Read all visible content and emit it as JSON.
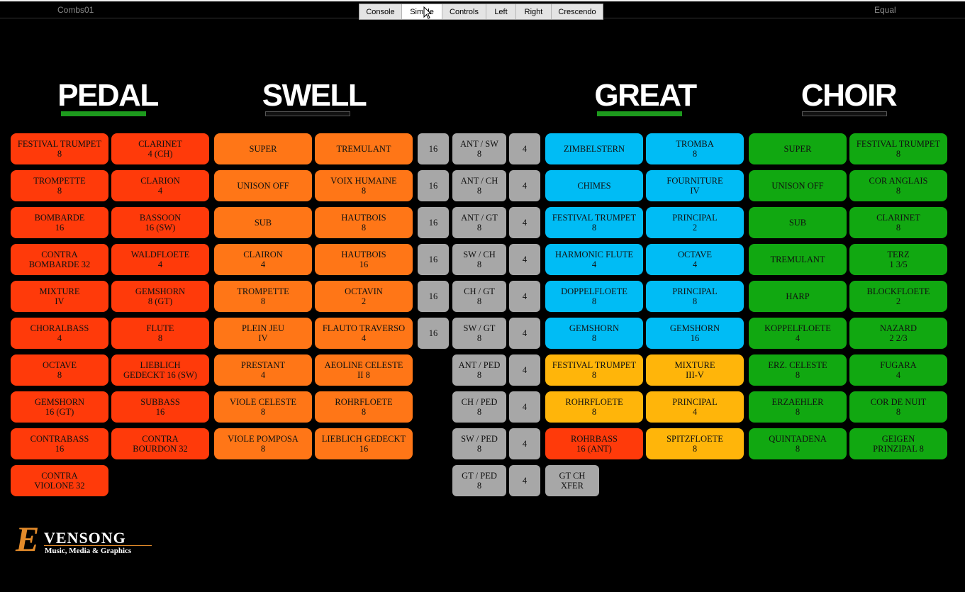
{
  "window": {
    "combination_name": "Combs01",
    "temperament": "Equal"
  },
  "tabs": [
    "Console",
    "Simple",
    "Controls",
    "Left",
    "Right",
    "Crescendo"
  ],
  "divisions": {
    "pedal": "PEDAL",
    "swell": "SWELL",
    "great": "GREAT",
    "choir": "CHOIR"
  },
  "pedal": {
    "col1": [
      "FESTIVAL TRUMPET\n8",
      "TROMPETTE\n8",
      "BOMBARDE\n16",
      "CONTRA\nBOMBARDE 32",
      "MIXTURE\nIV",
      "CHORALBASS\n4",
      "OCTAVE\n8",
      "GEMSHORN\n16 (GT)",
      "CONTRABASS\n16",
      "CONTRA\nVIOLONE 32"
    ],
    "col2": [
      "CLARINET\n4 (CH)",
      "CLARION\n4",
      "BASSOON\n16 (SW)",
      "WALDFLOETE\n4",
      "GEMSHORN\n8 (GT)",
      "FLUTE\n8",
      "LIEBLICH\nGEDECKT 16 (SW)",
      "SUBBASS\n16",
      "CONTRA\nBOURDON 32"
    ]
  },
  "swell": {
    "col1": [
      "SUPER",
      "UNISON OFF",
      "SUB",
      "CLAIRON\n4",
      "TROMPETTE\n8",
      "PLEIN JEU\nIV",
      "PRESTANT\n4",
      "VIOLE CELESTE\n8",
      "VIOLE POMPOSA\n8"
    ],
    "col2": [
      "TREMULANT",
      "VOIX HUMAINE\n8",
      "HAUTBOIS\n8",
      "HAUTBOIS\n16",
      "OCTAVIN\n2",
      "FLAUTO TRAVERSO\n4",
      "AEOLINE CELESTE\nII 8",
      "ROHRFLOETE\n8",
      "LIEBLICH GEDECKT\n16"
    ]
  },
  "couplers": {
    "left16": [
      "16",
      "16",
      "16",
      "16",
      "16",
      "16"
    ],
    "mid": [
      "ANT / SW\n8",
      "ANT / CH\n8",
      "ANT / GT\n8",
      "SW / CH\n8",
      "CH / GT\n8",
      "SW / GT\n8",
      "ANT / PED 8",
      "CH / PED\n8",
      "SW / PED\n8",
      "GT / PED\n8"
    ],
    "right4": [
      "4",
      "4",
      "4",
      "4",
      "4",
      "4",
      "4",
      "4",
      "4",
      "4"
    ],
    "transfer": "GT CH\nXFER"
  },
  "great": {
    "col1": [
      "ZIMBELSTERN",
      "CHIMES",
      "FESTIVAL TRUMPET\n8",
      "HARMONIC FLUTE\n4",
      "DOPPELFLOETE\n8",
      "GEMSHORN\n8",
      "FESTIVAL TRUMPET\n8",
      "ROHRFLOETE\n8",
      "ROHRBASS\n16 (ANT)"
    ],
    "col2": [
      "TROMBA\n8",
      "FOURNITURE\nIV",
      "PRINCIPAL\n2",
      "OCTAVE\n4",
      "PRINCIPAL\n8",
      "GEMSHORN\n16",
      "MIXTURE\nIII-V",
      "PRINCIPAL\n4",
      "SPITZFLOETE\n8"
    ]
  },
  "choir": {
    "col1": [
      "SUPER",
      "UNISON OFF",
      "SUB",
      "TREMULANT",
      "HARP",
      "KOPPELFLOETE\n4",
      "ERZ. CELESTE\n8",
      "ERZAEHLER\n8",
      "QUINTADENA\n8"
    ],
    "col2": [
      "FESTIVAL TRUMPET\n8",
      "COR ANGLAIS\n8",
      "CLARINET\n8",
      "TERZ\n1 3/5",
      "BLOCKFLOETE\n2",
      "NAZARD\n2 2/3",
      "FUGARA\n4",
      "COR DE NUIT\n8",
      "GEIGEN\nPRINZIPAL 8"
    ]
  },
  "logo": {
    "letter": "E",
    "name": "VENSONG",
    "tagline": "Music, Media & Graphics"
  },
  "colors": {
    "pedal": "#ff3a0a",
    "swell": "#ff7617",
    "great": "#00bcf5",
    "great_reed": "#ffb50a",
    "choir": "#11a811",
    "coupler": "#a7a7a7",
    "indicator_on": "#1d9a1d"
  }
}
